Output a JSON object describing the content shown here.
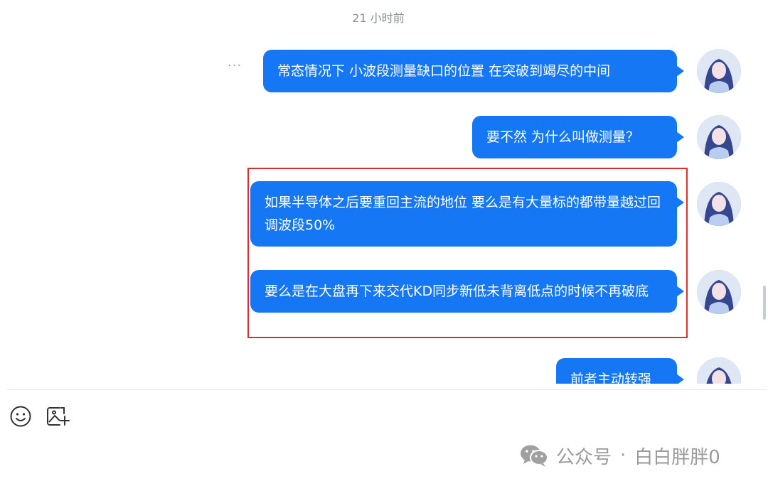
{
  "chat": {
    "timestamp": "21 小时前",
    "more_label": "···",
    "messages": [
      {
        "text": "常态情况下 小波段测量缺口的位置 在突破到竭尽的中间"
      },
      {
        "text": "要不然 为什么叫做测量？"
      },
      {
        "text": "如果半导体之后要重回主流的地位 要么是有大量标的都带量越过回调波段50%"
      },
      {
        "text": "要么是在大盘再下来交代KD同步新低未背离低点的时候不再破底"
      },
      {
        "text": "前者主动转强"
      }
    ]
  },
  "composer": {
    "tools": [
      {
        "icon": "emoji-icon"
      },
      {
        "icon": "image-upload-icon"
      }
    ]
  },
  "watermark": {
    "icon": "wechat-icon",
    "prefix": "公众号",
    "separator": "·",
    "account": "白白胖胖0"
  },
  "colors": {
    "bubble": "#1677f5",
    "highlight": "#d9302e",
    "timestamp": "#8a8f99",
    "watermark": "#9a9a9a"
  }
}
